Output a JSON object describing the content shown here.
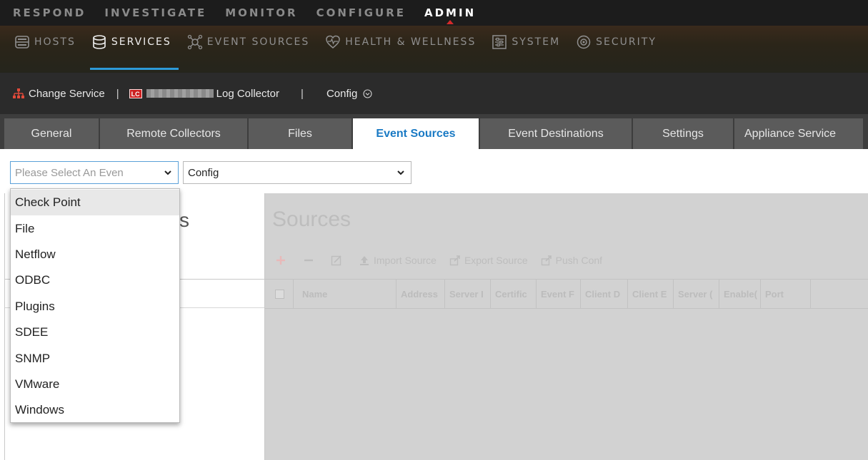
{
  "topnav": {
    "items": [
      {
        "label": "RESPOND"
      },
      {
        "label": "INVESTIGATE"
      },
      {
        "label": "MONITOR"
      },
      {
        "label": "CONFIGURE"
      },
      {
        "label": "ADMIN"
      }
    ],
    "active": "ADMIN"
  },
  "subnav": {
    "items": [
      {
        "label": "HOSTS",
        "icon": "hosts-icon"
      },
      {
        "label": "SERVICES",
        "icon": "database-icon"
      },
      {
        "label": "EVENT SOURCES",
        "icon": "event-sources-icon"
      },
      {
        "label": "HEALTH & WELLNESS",
        "icon": "heartbeat-icon"
      },
      {
        "label": "SYSTEM",
        "icon": "sliders-icon"
      },
      {
        "label": "SECURITY",
        "icon": "shield-gear-icon"
      }
    ],
    "active": "SERVICES",
    "accent": "#2d9ad8"
  },
  "servicebar": {
    "change_service": "Change Service",
    "separator": "|",
    "badge": "LC",
    "service_name": "Log Collector",
    "view": "Config"
  },
  "tabs": {
    "items": [
      {
        "label": "General"
      },
      {
        "label": "Remote Collectors"
      },
      {
        "label": "Files"
      },
      {
        "label": "Event Sources"
      },
      {
        "label": "Event Destinations"
      },
      {
        "label": "Settings"
      },
      {
        "label": "Appliance Service"
      }
    ],
    "active": "Event Sources",
    "active_color": "#1a7ac4"
  },
  "selects": {
    "event_type_placeholder": "Please Select An Even",
    "config_value": "Config"
  },
  "dropdown": {
    "options": [
      "Check Point",
      "File",
      "Netflow",
      "ODBC",
      "Plugins",
      "SDEE",
      "SNMP",
      "VMware",
      "Windows"
    ],
    "highlighted": "Check Point"
  },
  "left_panel": {
    "title_fragment": "s"
  },
  "sources": {
    "title": "Sources",
    "toolbar": {
      "import": "Import Source",
      "export": "Export Source",
      "push": "Push Conf"
    },
    "columns": [
      "Name",
      "Address",
      "Server I",
      "Certific",
      "Event F",
      "Client D",
      "Client E",
      "Server (",
      "Enable(",
      "Port"
    ]
  },
  "colors": {
    "topnav_bg": "#1c1c1c",
    "admin_marker": "#d62a2a",
    "badge": "#cc2020",
    "disabled_panel": "#d2d2d2"
  }
}
